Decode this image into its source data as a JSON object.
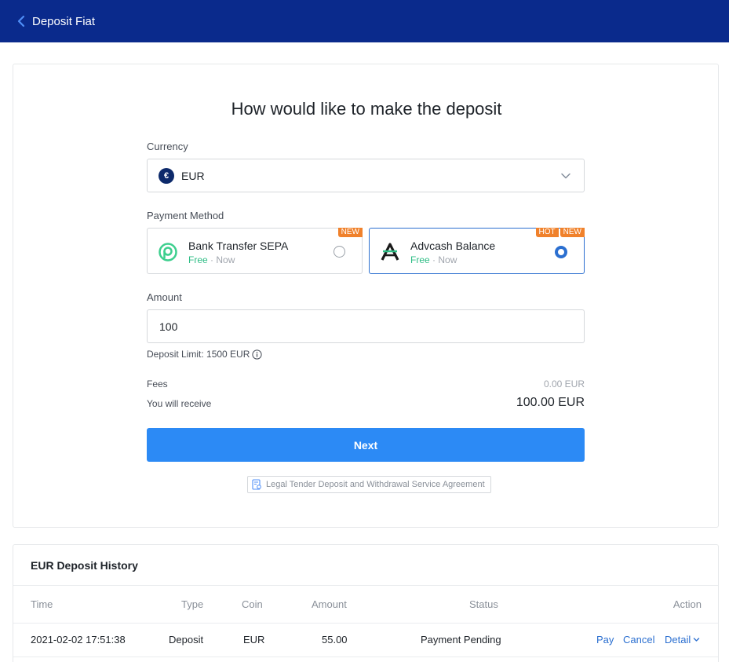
{
  "header": {
    "title": "Deposit Fiat"
  },
  "form": {
    "heading": "How would like to make the deposit",
    "currency_label": "Currency",
    "currency_value": "EUR",
    "currency_symbol": "€",
    "payment_label": "Payment Method",
    "payment_methods": [
      {
        "name": "Bank Transfer SEPA",
        "fee": "Free",
        "speed": "· Now",
        "badges": [
          "NEW"
        ],
        "selected": false
      },
      {
        "name": "Advcash Balance",
        "fee": "Free",
        "speed": "· Now",
        "badges": [
          "HOT",
          "NEW"
        ],
        "selected": true
      }
    ],
    "amount_label": "Amount",
    "amount_value": "100",
    "deposit_limit": "Deposit Limit: 1500 EUR",
    "fees_label": "Fees",
    "fees_value": "0.00 EUR",
    "receive_label": "You will receive",
    "receive_value": "100.00 EUR",
    "next_label": "Next",
    "agreement_label": "Legal Tender Deposit and Withdrawal Service Agreement"
  },
  "history": {
    "title": "EUR Deposit History",
    "columns": [
      "Time",
      "Type",
      "Coin",
      "Amount",
      "Status",
      "Action"
    ],
    "rows": [
      {
        "time": "2021-02-02 17:51:38",
        "type": "Deposit",
        "coin": "EUR",
        "amount": "55.00",
        "status": "Payment Pending",
        "actions": [
          "Pay",
          "Cancel",
          "Detail"
        ]
      }
    ]
  },
  "colors": {
    "header_bg": "#0a2a8c",
    "primary": "#2c8af5",
    "selected_border": "#2b6fd0",
    "badge": "#f0812b",
    "free_green": "#2ebd85"
  }
}
